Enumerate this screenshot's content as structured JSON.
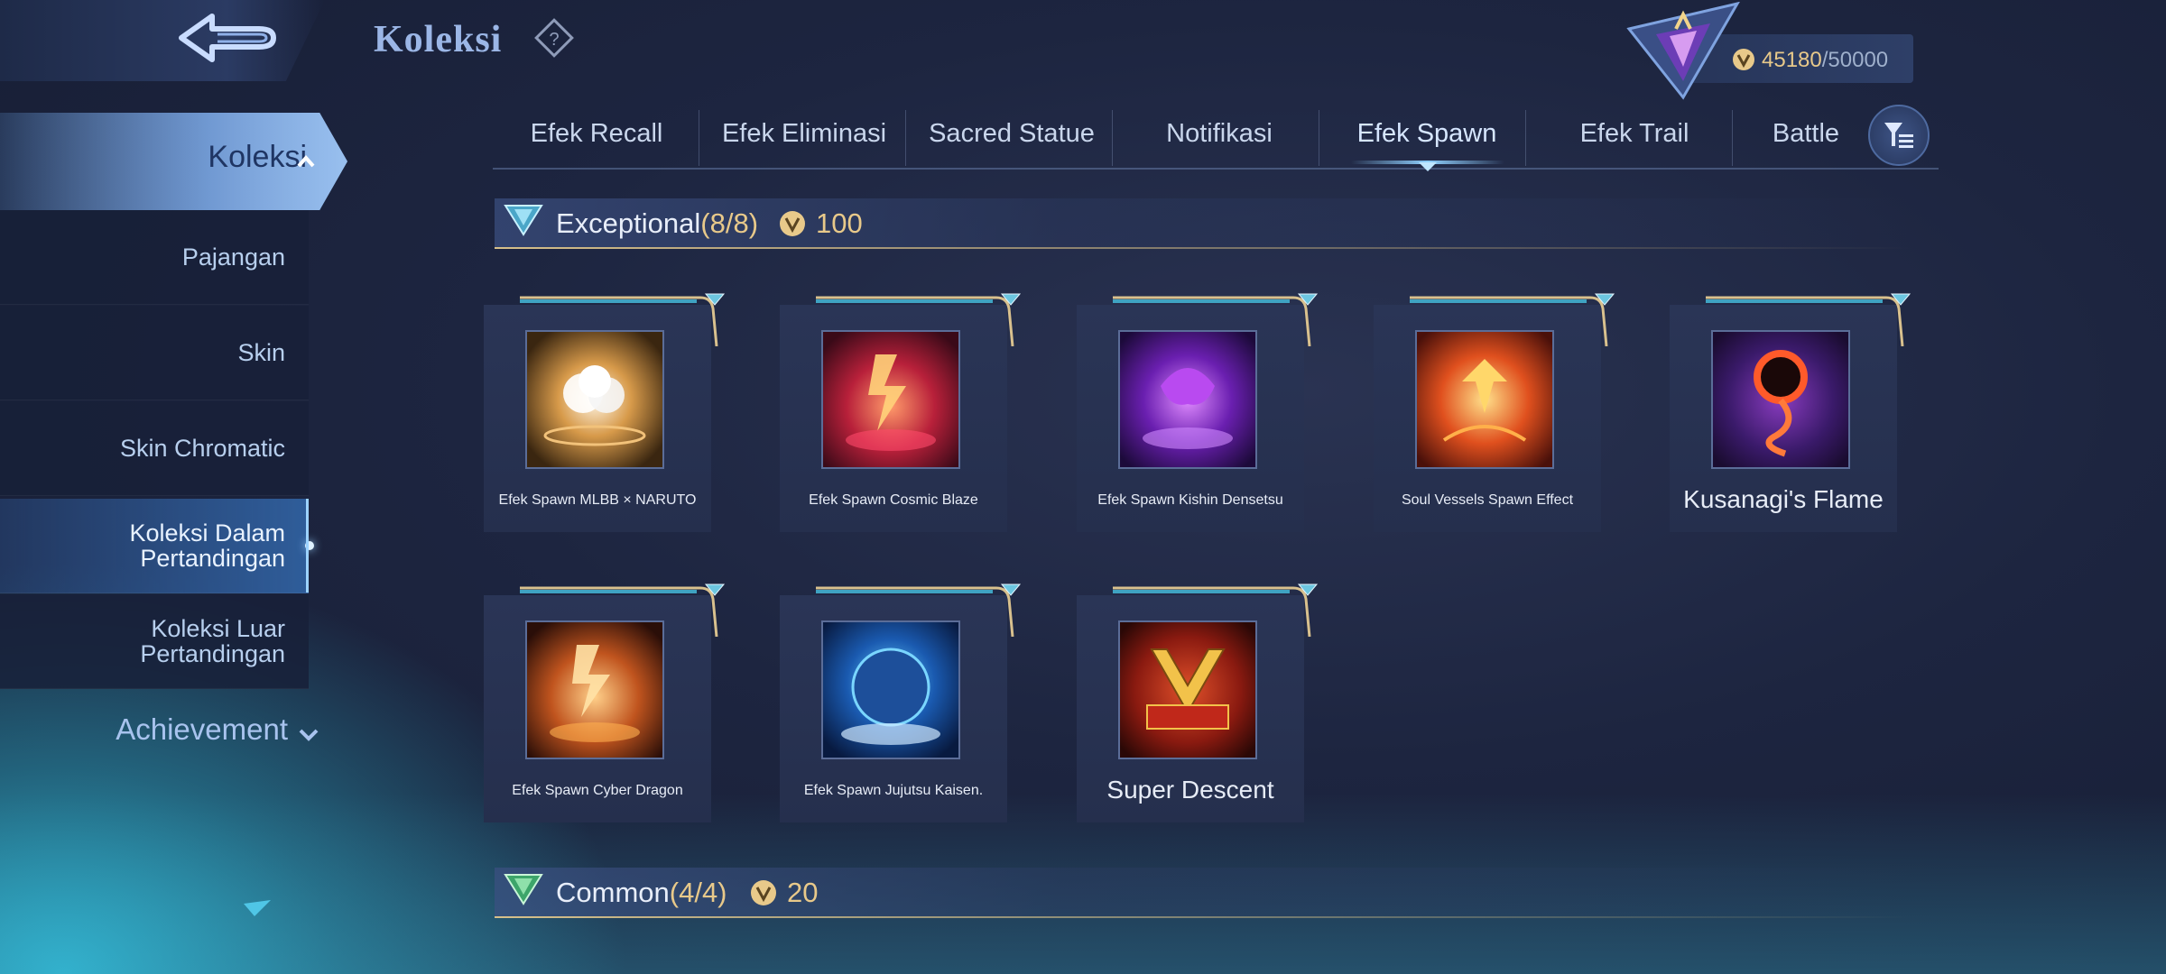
{
  "header": {
    "title": "Koleksi",
    "currency_value": "45180",
    "currency_max": "/50000"
  },
  "sidebar": {
    "main": "Koleksi",
    "items": [
      {
        "label": "Pajangan"
      },
      {
        "label": "Skin"
      },
      {
        "label": "Skin Chromatic"
      },
      {
        "label": "Koleksi Dalam Pertandingan"
      },
      {
        "label": "Koleksi Luar Pertandingan"
      }
    ],
    "achievement": "Achievement"
  },
  "tabs": [
    {
      "label": "Efek Recall"
    },
    {
      "label": "Efek Eliminasi"
    },
    {
      "label": "Sacred Statue"
    },
    {
      "label": "Notifikasi"
    },
    {
      "label": "Efek Spawn"
    },
    {
      "label": "Efek Trail"
    },
    {
      "label": "Battle"
    }
  ],
  "sections": [
    {
      "title": "Exceptional",
      "count": "(8/8)",
      "points": "100"
    },
    {
      "title": "Common",
      "count": "(4/4)",
      "points": "20"
    }
  ],
  "cards": [
    {
      "name": "Efek Spawn MLBB × NARUTO"
    },
    {
      "name": "Efek Spawn Cosmic Blaze"
    },
    {
      "name": "Efek Spawn Kishin Densetsu"
    },
    {
      "name": "Soul Vessels Spawn Effect"
    },
    {
      "name": "Kusanagi's Flame"
    },
    {
      "name": "Efek Spawn Cyber Dragon"
    },
    {
      "name": "Efek Spawn Jujutsu Kaisen."
    },
    {
      "name": "Super Descent"
    }
  ],
  "colors": {
    "accent": "#8fd0ff",
    "gold": "#e8c98a",
    "background": "#1d2540"
  }
}
